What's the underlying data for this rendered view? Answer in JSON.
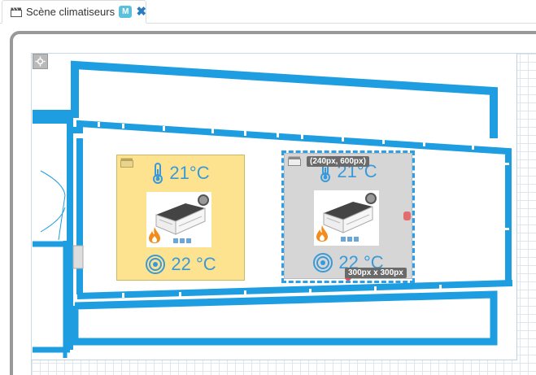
{
  "tab": {
    "title": "Scène climatiseurs",
    "badge": "M",
    "close_glyph": "✖",
    "icon": "clapperboard-icon"
  },
  "canvas": {
    "toolbar_icon": "settings-icon"
  },
  "widgets": [
    {
      "name": "left",
      "state": "heating",
      "ambient_temp": "21°C",
      "setpoint_temp": "22 °C",
      "background": "#fde38f",
      "status_color": "#999999"
    },
    {
      "name": "right",
      "state": "heating",
      "ambient_temp": "21°C",
      "setpoint_temp": "22 °C",
      "background": "#d6d6d6",
      "status_color": "#999999",
      "selected": true
    }
  ],
  "selection": {
    "position_label": "(240px, 600px)",
    "size_label": "300px x 300px"
  },
  "colors": {
    "wall": "#1e9ee0",
    "accent": "#3a9ad9",
    "selection": "#2e9fe6",
    "handle": "#e36c6c"
  }
}
